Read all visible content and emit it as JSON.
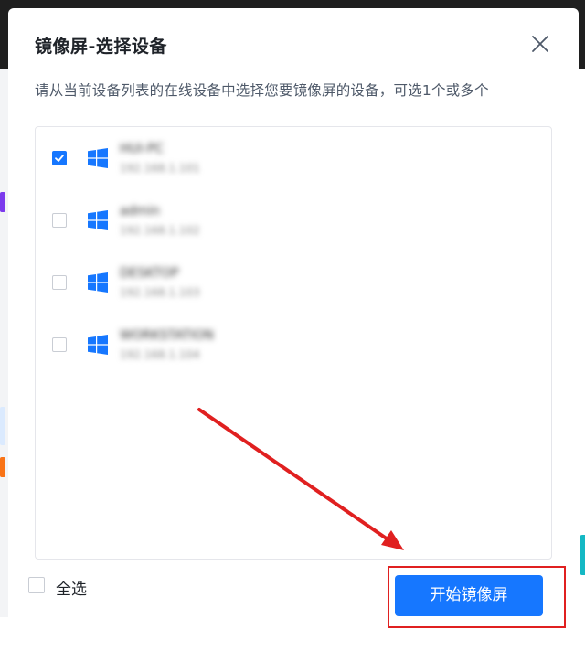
{
  "dialog": {
    "title": "镜像屏-选择设备",
    "subtitle": "请从当前设备列表的在线设备中选择您要镜像屏的设备，可选1个或多个"
  },
  "devices": [
    {
      "name": "HUI-PC",
      "ip": "192.168.1.101",
      "checked": true,
      "os_icon": "windows-icon"
    },
    {
      "name": "admin",
      "ip": "192.168.1.102",
      "checked": false,
      "os_icon": "windows-icon"
    },
    {
      "name": "DESKTOP",
      "ip": "192.168.1.103",
      "checked": false,
      "os_icon": "windows-icon"
    },
    {
      "name": "WORKSTATION",
      "ip": "192.168.1.104",
      "checked": false,
      "os_icon": "windows-icon"
    }
  ],
  "footer": {
    "select_all_label": "全选",
    "select_all_checked": false,
    "start_button_label": "开始镜像屏"
  },
  "colors": {
    "primary": "#1677ff",
    "annotation": "#e02020",
    "windows_blue": "#1677ff"
  }
}
